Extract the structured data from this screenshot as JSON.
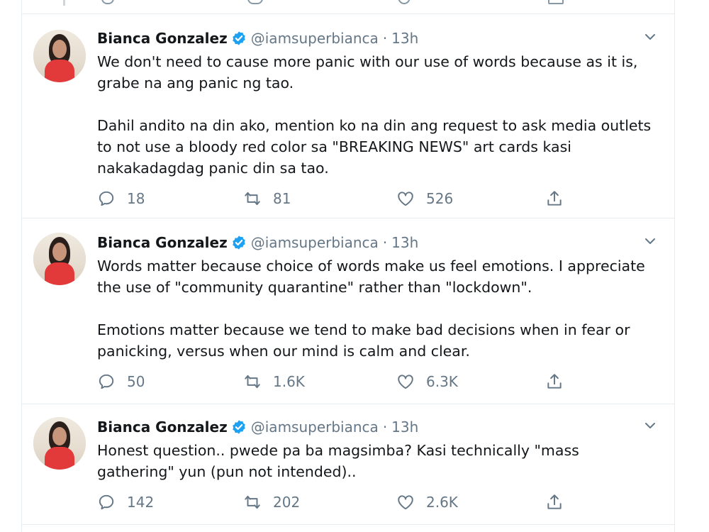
{
  "tweets": [
    {
      "name": "Bianca Gonzalez",
      "handle": "@iamsuperbianca",
      "separator": "·",
      "time": "13h",
      "text": [
        "We don't need to cause more panic with our use of words because as it is, grabe na ang panic ng tao.",
        "Dahil andito na din ako, mention ko na din ang request to ask media outlets to not use a bloody red color sa \"BREAKING NEWS\" art cards kasi nakakadagdag panic din sa tao."
      ],
      "replies": "18",
      "retweets": "81",
      "likes": "526"
    },
    {
      "name": "Bianca Gonzalez",
      "handle": "@iamsuperbianca",
      "separator": "·",
      "time": "13h",
      "text": [
        "Words matter because choice of words make us feel emotions. I appreciate the use of \"community quarantine\" rather than \"lockdown\".",
        "Emotions matter because we tend to make bad decisions when in fear or panicking, versus when our mind is calm and clear."
      ],
      "replies": "50",
      "retweets": "1.6K",
      "likes": "6.3K"
    },
    {
      "name": "Bianca Gonzalez",
      "handle": "@iamsuperbianca",
      "separator": "·",
      "time": "13h",
      "text": [
        "Honest question.. pwede pa ba magsimba? Kasi technically \"mass gathering\" yun (pun not intended).."
      ],
      "replies": "142",
      "retweets": "202",
      "likes": "2.6K"
    }
  ],
  "icons": {
    "reply": "reply-icon",
    "retweet": "retweet-icon",
    "like": "like-icon",
    "share": "share-icon",
    "verified": "verified-badge-icon",
    "caret": "chevron-down-icon"
  },
  "colors": {
    "verified": "#1da1f2",
    "muted": "#657786",
    "border": "#e6ecf0",
    "text": "#14171a"
  }
}
